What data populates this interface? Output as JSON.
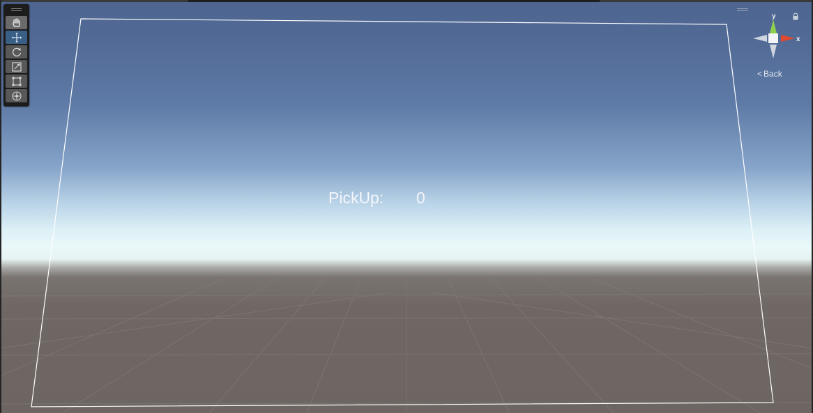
{
  "scene_view": {
    "tools": [
      {
        "name": "hand-tool",
        "icon": "hand-icon",
        "active": false
      },
      {
        "name": "move-tool",
        "icon": "move-icon",
        "active": true
      },
      {
        "name": "rotate-tool",
        "icon": "rotate-icon",
        "active": false
      },
      {
        "name": "scale-tool",
        "icon": "scale-icon",
        "active": false
      },
      {
        "name": "rect-tool",
        "icon": "rect-icon",
        "active": false
      },
      {
        "name": "transform-tool",
        "icon": "transform-icon",
        "active": false
      }
    ],
    "ui_text": {
      "pickup_label": "PickUp:",
      "pickup_value": "0"
    },
    "gizmo": {
      "y_label": "y",
      "x_label": "x",
      "projection_label": "Back",
      "y_color": "#8fd14f",
      "x_color": "#e0482f",
      "neutral_color": "#cfd6df"
    },
    "colors": {
      "active_tool": "#3a5f86",
      "canvas_outline": "#ffffff"
    }
  }
}
